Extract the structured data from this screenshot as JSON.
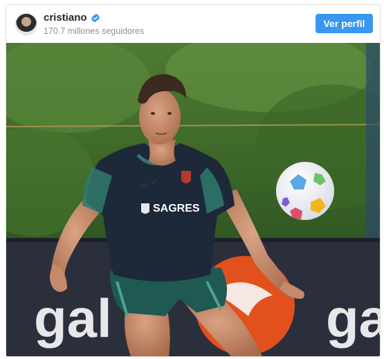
{
  "post": {
    "username": "cristiano",
    "verified": true,
    "followers_text": "170.7 millones seguidores",
    "profile_button_label": "Ver perfil"
  },
  "photo": {
    "shirt_sponsor": "SAGRES",
    "banner_text_left": "gal",
    "banner_text_right": "ga"
  },
  "colors": {
    "accent": "#3897f0",
    "verified_badge": "#3897f0",
    "username": "#262626",
    "secondary_text": "#8e8e8e"
  },
  "icons": {
    "verified": "verified-badge-icon"
  }
}
